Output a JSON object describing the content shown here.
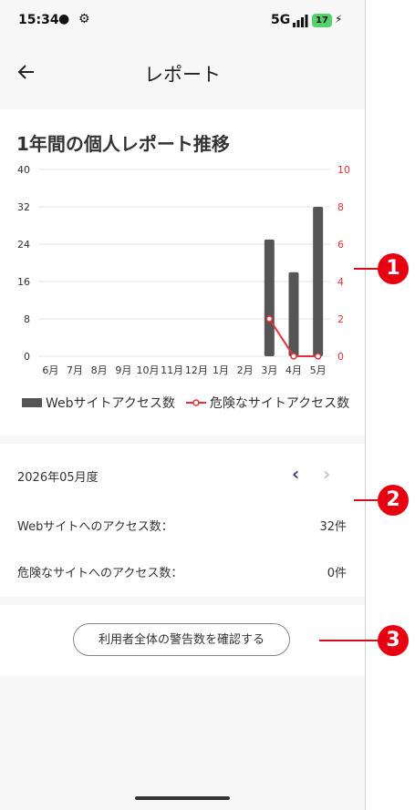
{
  "status_bar": {
    "time": "15:34",
    "network": "5G",
    "battery": "17"
  },
  "header": {
    "title": "レポート"
  },
  "chart_section": {
    "title": "1年間の個人レポート推移"
  },
  "chart_data": {
    "type": "bar",
    "categories": [
      "6月",
      "7月",
      "8月",
      "9月",
      "10月",
      "11月",
      "12月",
      "1月",
      "2月",
      "3月",
      "4月",
      "5月"
    ],
    "series": [
      {
        "name": "Webサイトアクセス数",
        "type": "bar",
        "axis": "left",
        "color": "#555555",
        "values": [
          null,
          null,
          null,
          null,
          null,
          null,
          null,
          null,
          null,
          25,
          18,
          32
        ]
      },
      {
        "name": "危険なサイトアクセス数",
        "type": "line",
        "axis": "right",
        "color": "#e8303a",
        "values": [
          null,
          null,
          null,
          null,
          null,
          null,
          null,
          null,
          null,
          2,
          0,
          0
        ]
      }
    ],
    "y_left": {
      "ticks": [
        "40",
        "32",
        "24",
        "16",
        "8",
        "0"
      ],
      "min": 0,
      "max": 40
    },
    "y_right": {
      "ticks": [
        "10",
        "8",
        "6",
        "4",
        "2",
        "0"
      ],
      "min": 0,
      "max": 10,
      "color": "#e8303a"
    },
    "grid": true,
    "legend": "bottom"
  },
  "legend": {
    "bar_label": "Webサイトアクセス数",
    "line_label": "危険なサイトアクセス数"
  },
  "summary": {
    "month": "2026年05月度",
    "web_access_label": "Webサイトへのアクセス数：",
    "web_access_value": "32件",
    "danger_access_label": "危険なサイトへのアクセス数：",
    "danger_access_value": "0件"
  },
  "actions": {
    "warn_button": "利用者全体の警告数を確認する"
  },
  "callouts": {
    "c1": "1",
    "c2": "2",
    "c3": "3"
  }
}
